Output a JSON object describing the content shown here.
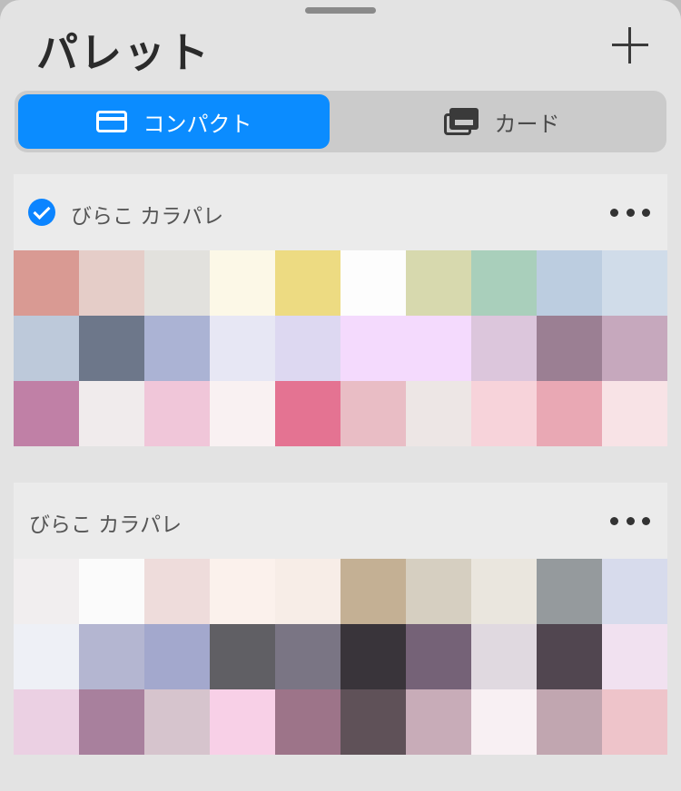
{
  "header": {
    "title": "パレット"
  },
  "segmented": {
    "compact_label": "コンパクト",
    "card_label": "カード"
  },
  "icons": {
    "add": "plus-icon",
    "compact": "compact-view-icon",
    "card": "card-view-icon",
    "check": "checkmark-icon",
    "more": "more-options-icon"
  },
  "accent_color": "#0b8cff",
  "palettes": [
    {
      "name": "びらこ カラパレ",
      "selected": true,
      "swatches": [
        "#d99a93",
        "#e5cdc8",
        "#e2e1dd",
        "#fcf8e7",
        "#eddb82",
        "#fdfdfd",
        "#d7d9ae",
        "#a9cfbb",
        "#bccde0",
        "#d0dce9",
        "#bdc9da",
        "#6d778a",
        "#abb3d4",
        "#e7e7f4",
        "#ddd8f1",
        "#f4dafd",
        "#f4dafd",
        "#dcc6dc",
        "#9b7f93",
        "#c6a8bd",
        "#c080a6",
        "#f0ebec",
        "#f0c6d9",
        "#f9f1f2",
        "#e47392",
        "#e9bdc5",
        "#ede6e5",
        "#f7d3da",
        "#e9a8b4",
        "#f8e3e6"
      ]
    },
    {
      "name": "びらこ カラパレ",
      "selected": false,
      "swatches": [
        "#f1eeef",
        "#fbfbfb",
        "#eedcdb",
        "#fbf1ec",
        "#f7ede7",
        "#c4b094",
        "#d6cfc1",
        "#eae6de",
        "#959a9d",
        "#d7dbec",
        "#eef0f6",
        "#b4b6d1",
        "#a3a8cd",
        "#605f64",
        "#7a7584",
        "#39343a",
        "#756277",
        "#e0d9e0",
        "#514650",
        "#f1e1f0",
        "#ebd0e3",
        "#a8809d",
        "#d6c4cd",
        "#f8d0e7",
        "#9d7489",
        "#5f5158",
        "#c8acb8",
        "#f8f0f3",
        "#c1a6b0",
        "#eec4ca"
      ]
    }
  ]
}
